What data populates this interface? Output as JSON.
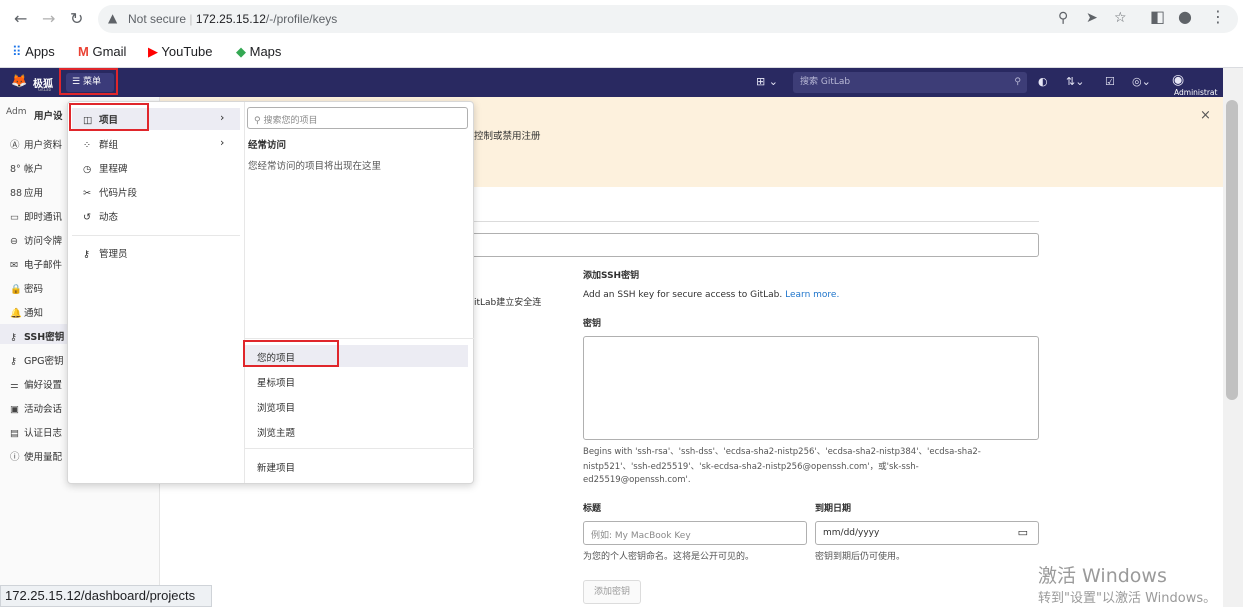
{
  "browser": {
    "url_prefix": "Not secure",
    "url_host": "172.25.15.12",
    "url_path": "/-/profile/keys",
    "bookmarks": [
      "Apps",
      "Gmail",
      "YouTube",
      "Maps"
    ],
    "status_url": "172.25.15.12/dashboard/projects"
  },
  "header": {
    "brand": "极狐",
    "brand_sub": "GitLab",
    "menu_label": "菜单",
    "search_placeholder": "搜索 GitLab",
    "user_label": "Administrat"
  },
  "sidebar": {
    "avatar_text": "Adm",
    "title": "用户设",
    "items": [
      {
        "icon": "user-icon",
        "label": "用户资料"
      },
      {
        "icon": "account-icon",
        "label": "帐户"
      },
      {
        "icon": "applications-icon",
        "label": "应用"
      },
      {
        "icon": "chat-icon",
        "label": "即时通讯"
      },
      {
        "icon": "token-icon",
        "label": "访问令牌"
      },
      {
        "icon": "mail-icon",
        "label": "电子邮件"
      },
      {
        "icon": "lock-icon",
        "label": "密码"
      },
      {
        "icon": "bell-icon",
        "label": "通知"
      },
      {
        "icon": "key-icon",
        "label": "SSH密钥"
      },
      {
        "icon": "key-icon",
        "label": "GPG密钥"
      },
      {
        "icon": "preferences-icon",
        "label": "偏好设置"
      },
      {
        "icon": "session-icon",
        "label": "活动会话"
      },
      {
        "icon": "log-icon",
        "label": "认证日志"
      },
      {
        "icon": "usage-icon",
        "label": "使用量配"
      }
    ]
  },
  "banner": {
    "text": "控制或禁用注册"
  },
  "main": {
    "ssh_fragment": "itLab建立安全连",
    "add_ssh_title": "添加SSH密钥",
    "add_ssh_desc": "Add an SSH key for secure access to GitLab.",
    "learn_more": "Learn more.",
    "key_label": "密钥",
    "key_help_1": "Begins with 'ssh-rsa'、'ssh-dss'、'ecdsa-sha2-nistp256'、'ecdsa-sha2-nistp384'、'ecdsa-sha2-",
    "key_help_2": "nistp521'、'ssh-ed25519'、'sk-ecdsa-sha2-nistp256@openssh.com'，或'sk-ssh-",
    "key_help_3": "ed25519@openssh.com'.",
    "title_label": "标题",
    "title_placeholder": "例如: My MacBook Key",
    "title_help": "为您的个人密钥命名。这将是公开可见的。",
    "expiry_label": "到期日期",
    "expiry_placeholder": "mm/dd/yyyy",
    "expiry_help": "密钥到期后仍可使用。",
    "add_key_button": "添加密钥"
  },
  "dropdown": {
    "left_items": [
      {
        "icon": "project-icon",
        "label": "项目"
      },
      {
        "icon": "group-icon",
        "label": "群组"
      },
      {
        "icon": "milestone-icon",
        "label": "里程碑"
      },
      {
        "icon": "snippet-icon",
        "label": "代码片段"
      },
      {
        "icon": "activity-icon",
        "label": "动态"
      }
    ],
    "admin_label": "管理员",
    "search_placeholder": "搜索您的项目",
    "frequent_title": "经常访问",
    "frequent_empty": "您经常访问的项目将出现在这里",
    "links": [
      "您的项目",
      "星标项目",
      "浏览项目",
      "浏览主题"
    ],
    "new_project": "新建项目"
  },
  "watermark": {
    "line1": "激活 Windows",
    "line2": "转到\"设置\"以激活 Windows。"
  },
  "colors": {
    "gitlab_header": "#292961",
    "banner": "#fdf1dd",
    "highlight_box": "#e0262b",
    "link": "#1f75cb"
  }
}
